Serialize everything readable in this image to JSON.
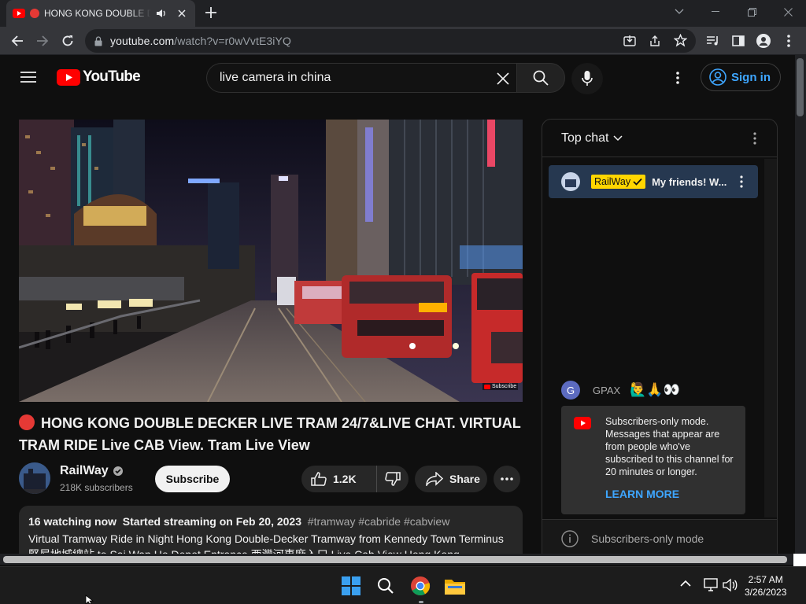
{
  "browser": {
    "tab_title": "HONG KONG DOUBLE D",
    "url_host": "youtube.com",
    "url_path": "/watch?v=r0wVvtE3iYQ"
  },
  "youtube": {
    "logo_text": "YouTube",
    "search_value": "live camera in china",
    "signin_label": "Sign in"
  },
  "video": {
    "title": "HONG KONG DOUBLE DECKER LIVE TRAM 24/7&LIVE CHAT. VIRTUAL TRAM RIDE Live CAB View. Tram Live View",
    "overlay_subscribe": "Subscribe",
    "channel_name": "RailWay",
    "subscribers": "218K subscribers",
    "subscribe_label": "Subscribe",
    "likes": "1.2K",
    "share_label": "Share",
    "watching": "16 watching now",
    "started": "Started streaming on Feb 20, 2023",
    "tags": "#tramway #cabride #cabview",
    "description": "Virtual Tramway Ride in Night Hong Kong Double-Decker Tramway from Kennedy Town Terminus 堅尼地城總站 to Sai Wan Ho Depot Entrance 西灣河車廠入口 Live Cab View Hong Kong"
  },
  "chat": {
    "header": "Top chat",
    "pinned_author": "RailWay",
    "pinned_message": "My friends! W...",
    "msg_author_initial": "G",
    "msg_author": "GPAX",
    "msg_text": "🙋‍♂️🙏👀",
    "notice": "Subscribers-only mode. Messages that appear are from people who've subscribed to this channel for 20 minutes or longer.",
    "learn_more": "LEARN MORE",
    "footer": "Subscribers-only mode"
  },
  "taskbar": {
    "time": "2:57 AM",
    "date": "3/26/2023"
  },
  "colors": {
    "accent_blue": "#3ea6ff",
    "yt_red": "#ff0000",
    "pinned_bg": "#263850",
    "badge_yellow": "#ffd600"
  },
  "icons": [
    "youtube-favicon",
    "record-icon",
    "speaker-icon",
    "close-icon",
    "plus-icon",
    "back-icon",
    "forward-icon",
    "reload-icon",
    "lock-icon",
    "install-icon",
    "share-icon",
    "star-icon",
    "media-icon",
    "sidepanel-icon",
    "profile-icon",
    "kebab-icon",
    "hamburger-icon",
    "search-icon",
    "mic-icon",
    "account-icon",
    "verified-icon",
    "thumbs-up-icon",
    "thumbs-down-icon",
    "share-arrow-icon",
    "more-icon",
    "chevron-down-icon",
    "info-icon",
    "windows-icon",
    "chrome-icon",
    "folder-icon",
    "network-icon",
    "volume-icon"
  ]
}
